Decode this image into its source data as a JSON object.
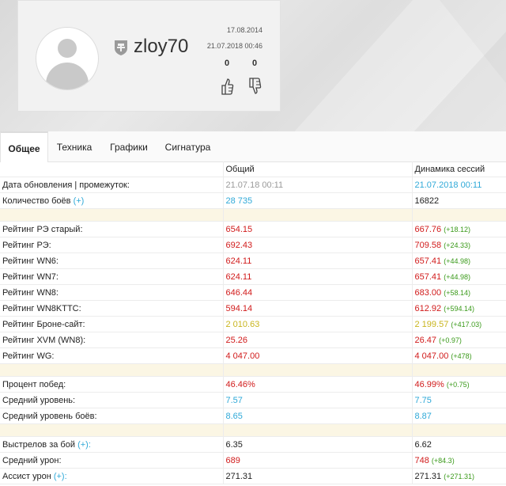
{
  "profile": {
    "username": "zloy70",
    "date_registered": "17.08.2014",
    "date_last": "21.07.2018 00:46",
    "likes": "0",
    "dislikes": "0"
  },
  "tabs": [
    {
      "label": "Общее",
      "active": true
    },
    {
      "label": "Техника",
      "active": false
    },
    {
      "label": "Графики",
      "active": false
    },
    {
      "label": "Сигнатура",
      "active": false
    }
  ],
  "table": {
    "col_general": "Общий",
    "col_dynamics": "Динамика сессий",
    "rows": [
      {
        "label": "Дата обновления | промежуток:",
        "general": "21.07.18 00:11",
        "general_color": "grey",
        "dyn": "21.07.2018 00:11",
        "dyn_color": "blue",
        "delta": ""
      },
      {
        "label": "Количество боёв",
        "plus": "(+)",
        "general": "28 735",
        "general_color": "blue",
        "dyn": "16822",
        "dyn_color": "dark",
        "delta": ""
      },
      {
        "spacer": true
      },
      {
        "label": "Рейтинг РЭ старый:",
        "general": "654.15",
        "general_color": "red",
        "dyn": "667.76",
        "dyn_color": "red",
        "delta": "(+18.12)"
      },
      {
        "label": "Рейтинг РЭ:",
        "general": "692.43",
        "general_color": "red",
        "dyn": "709.58",
        "dyn_color": "red",
        "delta": "(+24.33)"
      },
      {
        "label": "Рейтинг WN6:",
        "general": "624.11",
        "general_color": "red",
        "dyn": "657.41",
        "dyn_color": "red",
        "delta": "(+44.98)"
      },
      {
        "label": "Рейтинг WN7:",
        "general": "624.11",
        "general_color": "red",
        "dyn": "657.41",
        "dyn_color": "red",
        "delta": "(+44.98)"
      },
      {
        "label": "Рейтинг WN8:",
        "general": "646.44",
        "general_color": "red",
        "dyn": "683.00",
        "dyn_color": "red",
        "delta": "(+58.14)"
      },
      {
        "label": "Рейтинг WN8KTTC:",
        "general": "594.14",
        "general_color": "red",
        "dyn": "612.92",
        "dyn_color": "red",
        "delta": "(+594.14)"
      },
      {
        "label": "Рейтинг Броне-сайт:",
        "general": "2 010.63",
        "general_color": "yellow",
        "dyn": "2 199.57",
        "dyn_color": "yellow",
        "delta": "(+417.03)"
      },
      {
        "label": "Рейтинг XVM (WN8):",
        "general": "25.26",
        "general_color": "red",
        "dyn": "26.47",
        "dyn_color": "red",
        "delta": "(+0.97)"
      },
      {
        "label": "Рейтинг WG:",
        "general": "4 047.00",
        "general_color": "red",
        "dyn": "4 047.00",
        "dyn_color": "red",
        "delta": "(+478)"
      },
      {
        "spacer": true
      },
      {
        "label": "Процент побед:",
        "general": "46.46%",
        "general_color": "red",
        "dyn": "46.99%",
        "dyn_color": "red",
        "delta": "(+0.75)"
      },
      {
        "label": "Средний уровень:",
        "general": "7.57",
        "general_color": "blue",
        "dyn": "7.75",
        "dyn_color": "blue",
        "delta": ""
      },
      {
        "label": "Средний уровень боёв:",
        "general": "8.65",
        "general_color": "blue",
        "dyn": "8.87",
        "dyn_color": "blue",
        "delta": ""
      },
      {
        "spacer": true
      },
      {
        "label": "Выстрелов за бой",
        "plus": "(+):",
        "general": "6.35",
        "general_color": "dark",
        "dyn": "6.62",
        "dyn_color": "dark",
        "delta": ""
      },
      {
        "label": "Средний урон:",
        "general": "689",
        "general_color": "red",
        "dyn": "748",
        "dyn_color": "red",
        "delta": "(+84.3)"
      },
      {
        "label": "Ассист урон",
        "plus": "(+):",
        "general": "271.31",
        "general_color": "dark",
        "dyn": "271.31",
        "dyn_color": "dark",
        "delta": "(+271.31)"
      }
    ]
  },
  "icons": {
    "avatar": "user-avatar-icon",
    "game": "wot-logo-icon",
    "like": "thumbs-up-icon",
    "dislike": "thumbs-down-icon"
  }
}
